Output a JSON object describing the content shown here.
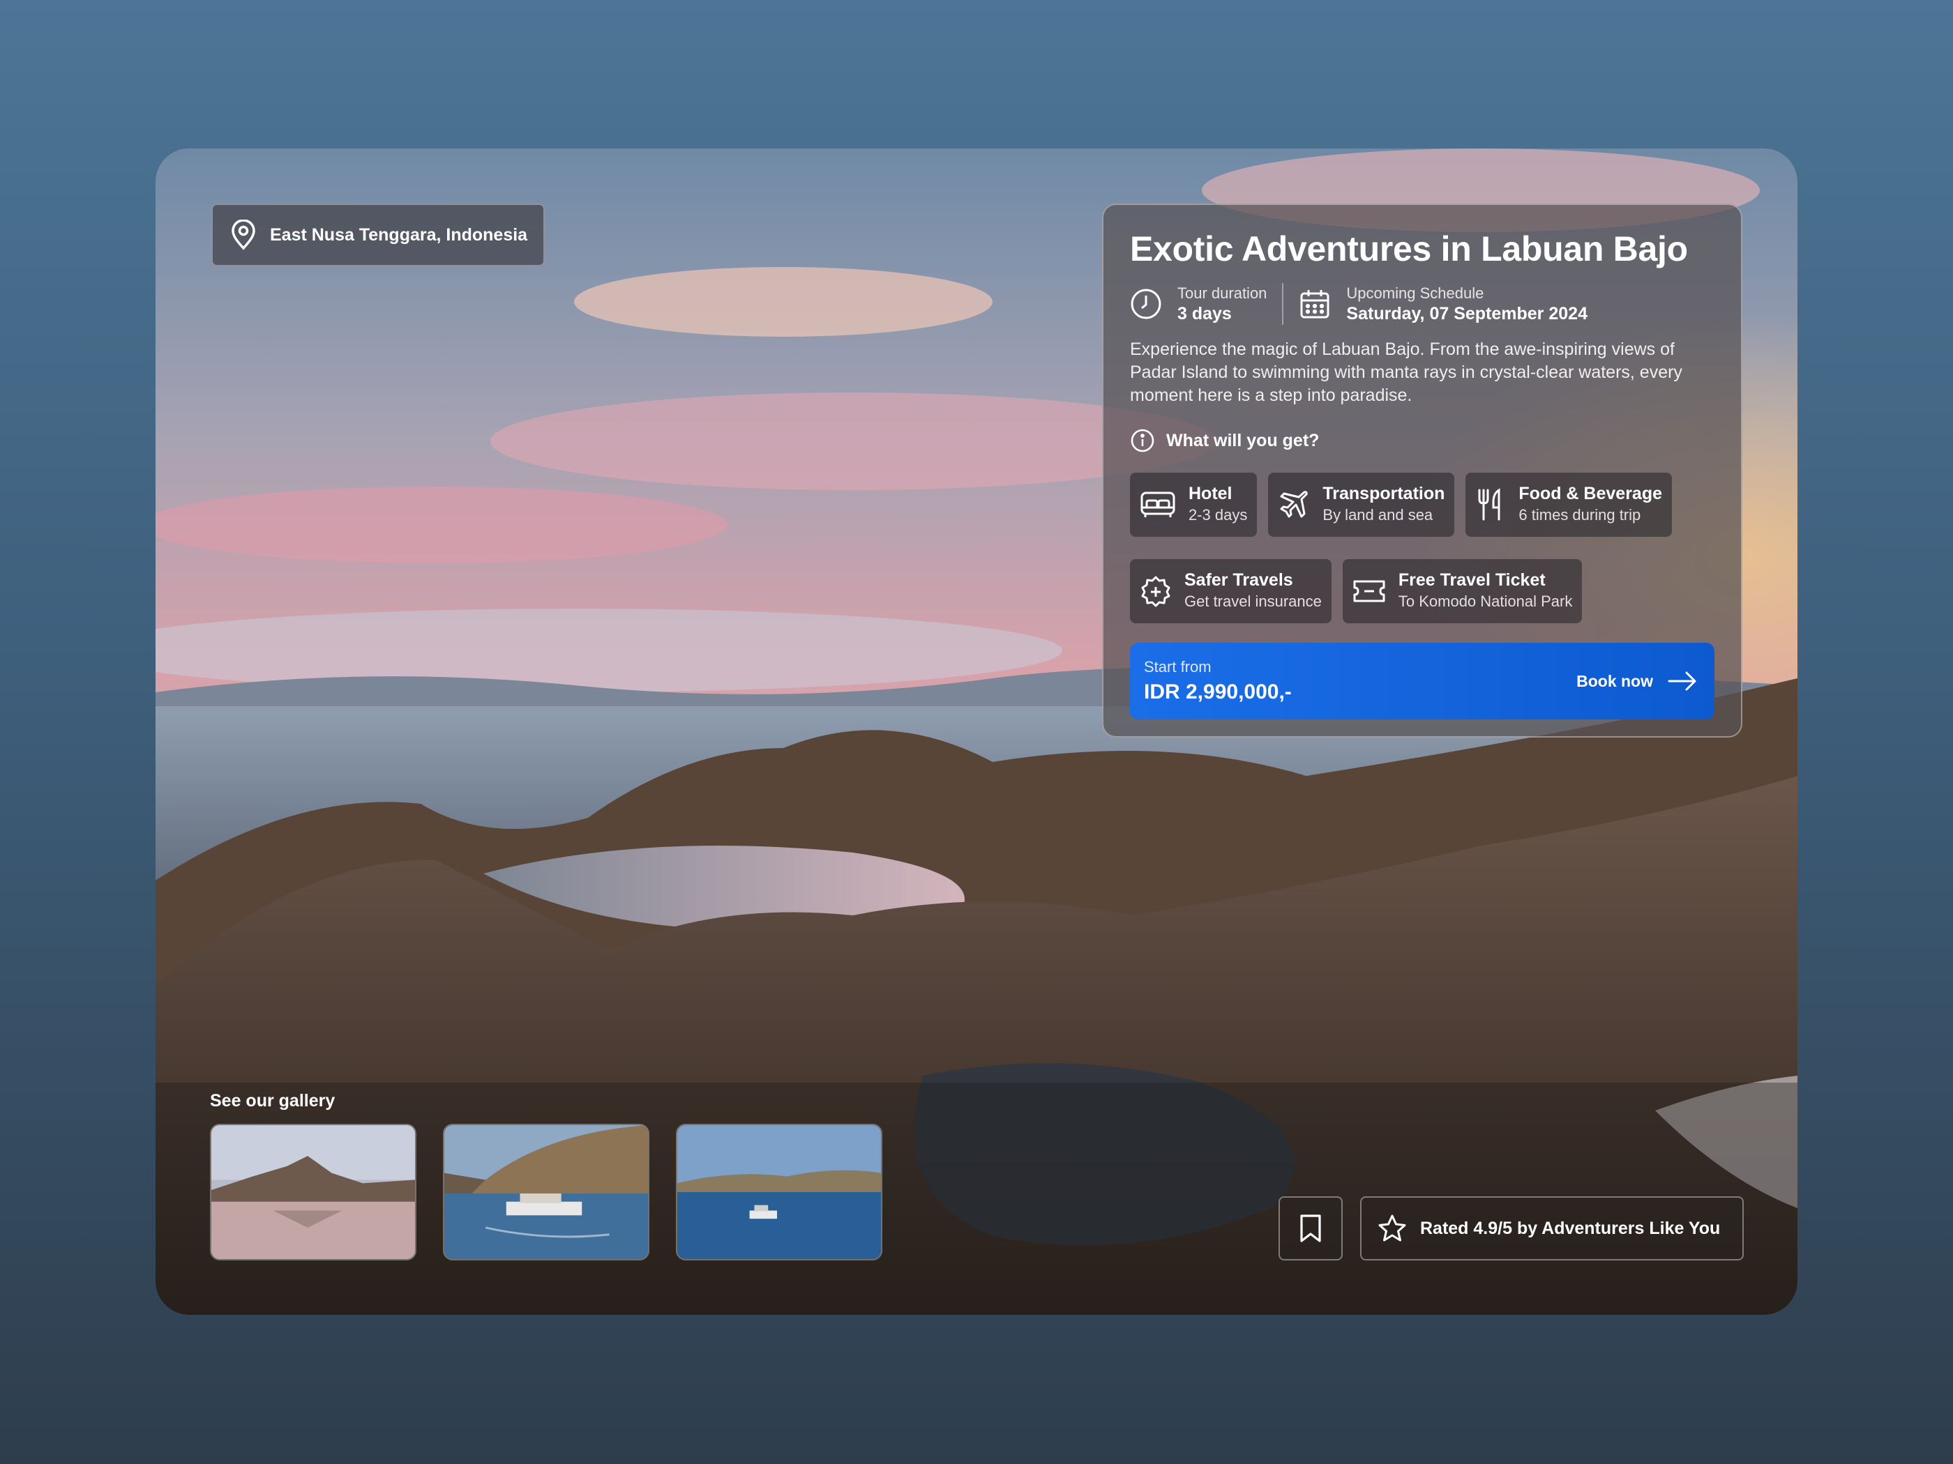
{
  "location": {
    "text": "East Nusa Tenggara, Indonesia",
    "icon": "map-pin-icon"
  },
  "tour": {
    "title": "Exotic Adventures in Labuan Bajo",
    "duration_label": "Tour duration",
    "duration_value": "3 days",
    "schedule_label": "Upcoming Schedule",
    "schedule_value": "Saturday, 07 September 2024",
    "description": "Experience the magic of Labuan Bajo. From the awe-inspiring views of Padar Island to swimming with manta rays in crystal-clear waters, every moment here is a step into paradise."
  },
  "includes": {
    "heading": "What will you get?",
    "items": [
      {
        "title": "Hotel",
        "subtitle": "2-3 days",
        "icon": "bed-icon"
      },
      {
        "title": "Transportation",
        "subtitle": "By land and sea",
        "icon": "airplane-icon"
      },
      {
        "title": "Food & Beverage",
        "subtitle": "6 times during trip",
        "icon": "fork-knife-icon"
      },
      {
        "title": "Safer Travels",
        "subtitle": "Get travel insurance",
        "icon": "shield-badge-icon"
      },
      {
        "title": "Free Travel Ticket",
        "subtitle": "To Komodo National Park",
        "icon": "ticket-icon"
      }
    ]
  },
  "booking": {
    "start_label": "Start from",
    "price": "IDR 2,990,000,-",
    "button_label": "Book now",
    "accent": "#1465de"
  },
  "gallery": {
    "title": "See our gallery",
    "count": 3
  },
  "rating": {
    "text": "Rated 4.9/5 by Adventurers Like You"
  }
}
